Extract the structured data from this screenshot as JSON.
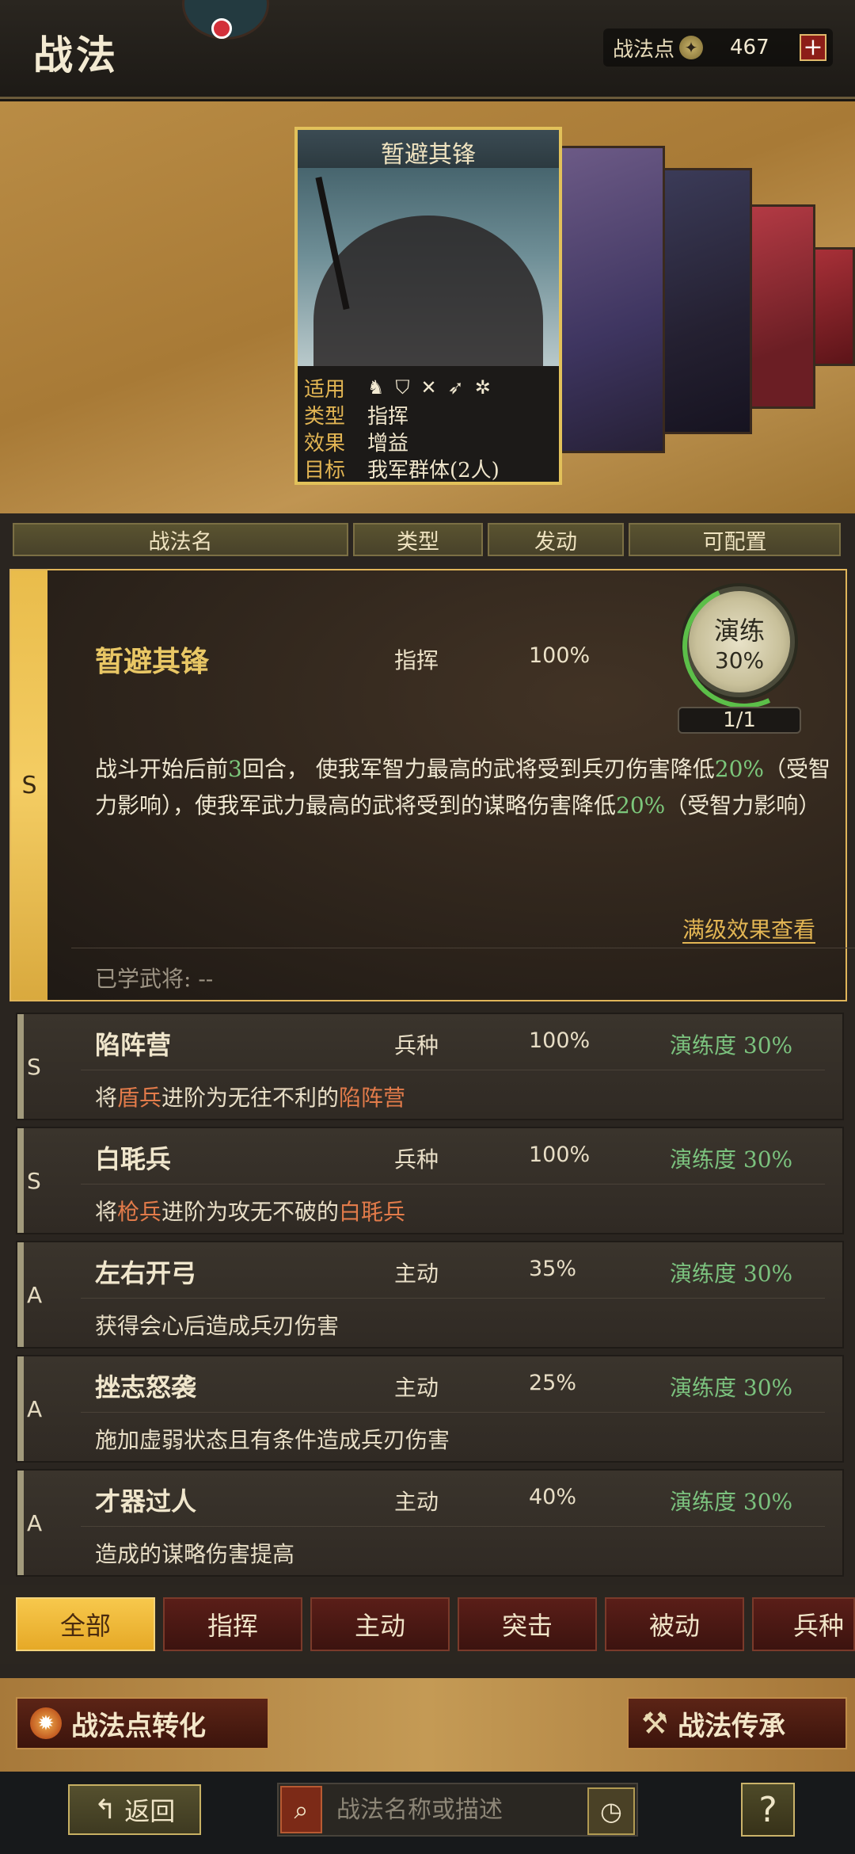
{
  "header": {
    "title": "战法",
    "points_label": "战法点",
    "points_value": "467",
    "plus": "+"
  },
  "card": {
    "name": "暂避其锋",
    "labels": {
      "apply": "适用",
      "type": "类型",
      "effect": "效果",
      "target": "目标"
    },
    "type_value": "指挥",
    "effect_value": "增益",
    "target_value": "我军群体(2人)",
    "unit_icons": [
      "cavalry-icon",
      "shield-icon",
      "bow-icon",
      "spear-icon",
      "wheel-icon"
    ]
  },
  "columns": [
    "战法名",
    "类型",
    "发动",
    "可配置"
  ],
  "selected": {
    "grade": "S",
    "name": "暂避其锋",
    "type": "指挥",
    "rate": "100%",
    "drill_label": "演练",
    "drill_value": "30%",
    "count": "1/1",
    "desc": {
      "p1": "战斗开始后前",
      "n1": "3",
      "p2": "回合， 使我军智力最高的武将受到兵刃伤害降低",
      "n2": "20%",
      "p3": "（受智力影响），使我军武力最高的武将受到的谋略伤害降低",
      "n3": "20%",
      "p4": "（受智力影响）"
    },
    "full_link": "满级效果查看",
    "learned": "已学武将: --"
  },
  "rows": [
    {
      "grade": "S",
      "name": "陷阵营",
      "type": "兵种",
      "rate": "100%",
      "practice": "演练度 30%",
      "d1": "将",
      "h1": "盾兵",
      "d2": "进阶为无往不利的",
      "h2": "陷阵营"
    },
    {
      "grade": "S",
      "name": "白毦兵",
      "type": "兵种",
      "rate": "100%",
      "practice": "演练度 30%",
      "d1": "将",
      "h1": "枪兵",
      "d2": "进阶为攻无不破的",
      "h2": "白毦兵"
    },
    {
      "grade": "A",
      "name": "左右开弓",
      "type": "主动",
      "rate": "35%",
      "practice": "演练度 30%",
      "d1": "获得会心后造成兵刃伤害",
      "h1": "",
      "d2": "",
      "h2": ""
    },
    {
      "grade": "A",
      "name": "挫志怒袭",
      "type": "主动",
      "rate": "25%",
      "practice": "演练度 30%",
      "d1": "施加虚弱状态且有条件造成兵刃伤害",
      "h1": "",
      "d2": "",
      "h2": ""
    },
    {
      "grade": "A",
      "name": "才器过人",
      "type": "主动",
      "rate": "40%",
      "practice": "演练度 30%",
      "d1": "造成的谋略伤害提高",
      "h1": "",
      "d2": "",
      "h2": ""
    }
  ],
  "tabs": [
    "全部",
    "指挥",
    "主动",
    "突击",
    "被动",
    "兵种"
  ],
  "buttons": {
    "convert": "战法点转化",
    "inherit": "战法传承",
    "back": "返回"
  },
  "search": {
    "placeholder": "战法名称或描述"
  },
  "help": "?"
}
